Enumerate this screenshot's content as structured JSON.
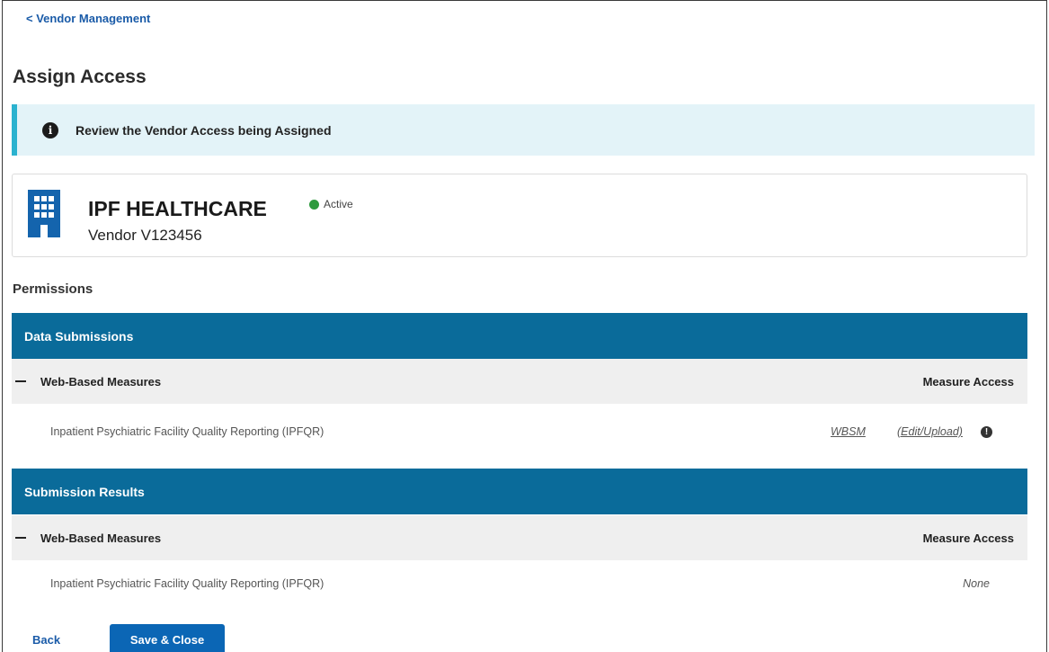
{
  "breadcrumb": "< Vendor Management",
  "page_title": "Assign Access",
  "alert": {
    "icon": "info-circle-icon",
    "icon_glyph": "i",
    "text": "Review the Vendor Access being Assigned"
  },
  "vendor": {
    "icon": "building-icon",
    "name": "IPF HEALTHCARE",
    "id": "Vendor V123456",
    "status": "Active",
    "status_color": "#2e9a3e"
  },
  "permissions_label": "Permissions",
  "sections": [
    {
      "title": "Data Submissions",
      "group": "Web-Based Measures",
      "access_header": "Measure Access",
      "row": {
        "measure": "Inpatient Psychiatric Facility Quality Reporting (IPFQR)",
        "type": "WBSM",
        "access": "(Edit/Upload)",
        "tip_glyph": "!"
      }
    },
    {
      "title": "Submission Results",
      "group": "Web-Based Measures",
      "access_header": "Measure Access",
      "row": {
        "measure": "Inpatient Psychiatric Facility Quality Reporting (IPFQR)",
        "access": "None"
      }
    }
  ],
  "footer": {
    "back_label": "Back",
    "save_label": "Save & Close"
  },
  "colors": {
    "section_header": "#0a6b9a",
    "alert_bg": "#e3f3f8",
    "alert_border": "#2bb2cf",
    "primary_button": "#0b66b5",
    "link": "#1a5ba8"
  }
}
